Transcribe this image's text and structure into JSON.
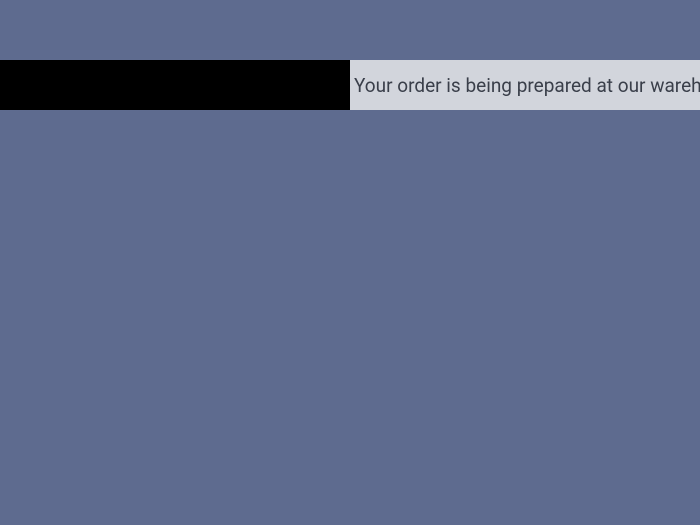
{
  "banner": {
    "message": "Your order is being prepared at our warehouse"
  }
}
